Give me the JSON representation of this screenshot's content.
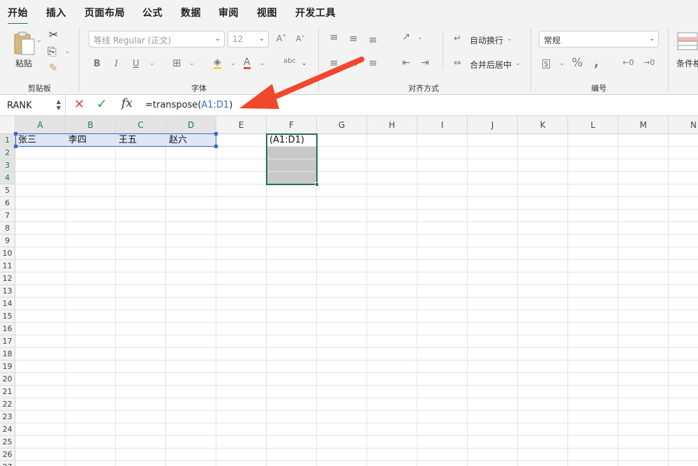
{
  "tabs": [
    "开始",
    "插入",
    "页面布局",
    "公式",
    "数据",
    "审阅",
    "视图",
    "开发工具"
  ],
  "ribbon": {
    "clipboard": {
      "paste_label": "粘贴",
      "group_label": "剪贴板"
    },
    "font": {
      "font_name": "等线 Regular (正文)",
      "font_size": "12",
      "group_label": "字体"
    },
    "alignment": {
      "wrap_label": "自动换行",
      "merge_label": "合并后居中",
      "group_label": "对齐方式"
    },
    "number": {
      "format": "常规",
      "group_label": "编号"
    },
    "styles": {
      "conditional_label": "条件格"
    }
  },
  "formula_bar": {
    "name_box": "RANK",
    "formula_prefix": "=transpose(",
    "formula_ref": "A1:D1",
    "formula_suffix": ")"
  },
  "grid": {
    "columns": [
      "A",
      "B",
      "C",
      "D",
      "E",
      "F",
      "G",
      "H",
      "I",
      "J",
      "K",
      "L",
      "M",
      "N"
    ],
    "rows": [
      "1",
      "2",
      "3",
      "4",
      "5",
      "6",
      "7",
      "8",
      "9",
      "10",
      "11",
      "12",
      "13",
      "14",
      "15",
      "16",
      "17",
      "18",
      "19",
      "20",
      "21",
      "22",
      "23",
      "24",
      "25",
      "26",
      "27"
    ],
    "cells": {
      "A1": "张三",
      "B1": "李四",
      "C1": "王五",
      "D1": "赵六",
      "F1": "(A1:D1)"
    }
  },
  "colors": {
    "accent": "#217346",
    "reference_blue": "#3a66c8",
    "arrow": "#f0472d",
    "range_highlight": "#dfe7f6",
    "array_fill": "#c8c8c8"
  }
}
